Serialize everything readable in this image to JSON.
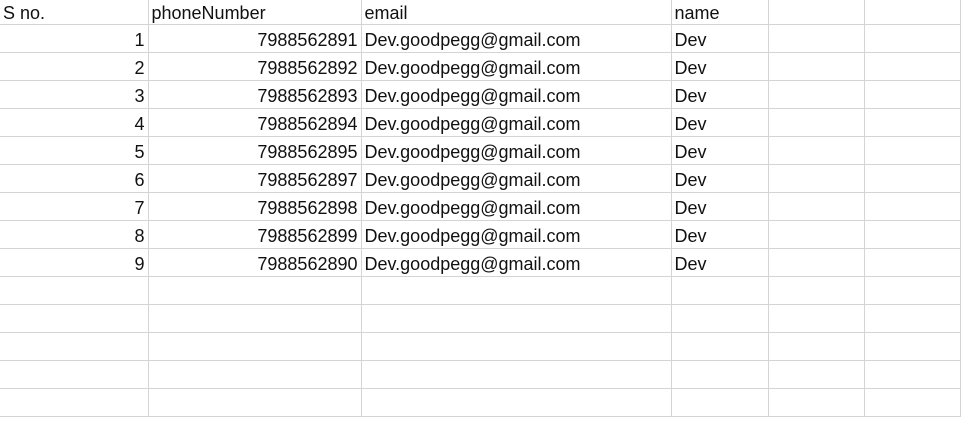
{
  "sheet": {
    "headers": [
      "S no.",
      "phoneNumber",
      "email",
      "name"
    ],
    "rows": [
      {
        "sno": "1",
        "phone": "7988562891",
        "email": "Dev.goodpegg@gmail.com",
        "name": "Dev"
      },
      {
        "sno": "2",
        "phone": "7988562892",
        "email": "Dev.goodpegg@gmail.com",
        "name": "Dev"
      },
      {
        "sno": "3",
        "phone": "7988562893",
        "email": "Dev.goodpegg@gmail.com",
        "name": "Dev"
      },
      {
        "sno": "4",
        "phone": "7988562894",
        "email": "Dev.goodpegg@gmail.com",
        "name": "Dev"
      },
      {
        "sno": "5",
        "phone": "7988562895",
        "email": "Dev.goodpegg@gmail.com",
        "name": "Dev"
      },
      {
        "sno": "6",
        "phone": "7988562897",
        "email": "Dev.goodpegg@gmail.com",
        "name": "Dev"
      },
      {
        "sno": "7",
        "phone": "7988562898",
        "email": "Dev.goodpegg@gmail.com",
        "name": "Dev"
      },
      {
        "sno": "8",
        "phone": "7988562899",
        "email": "Dev.goodpegg@gmail.com",
        "name": "Dev"
      },
      {
        "sno": "9",
        "phone": "7988562890",
        "email": "Dev.goodpegg@gmail.com",
        "name": "Dev"
      }
    ]
  },
  "colors": {
    "gridline": "#d4d4d4",
    "text": "#111111",
    "background": "#ffffff"
  }
}
